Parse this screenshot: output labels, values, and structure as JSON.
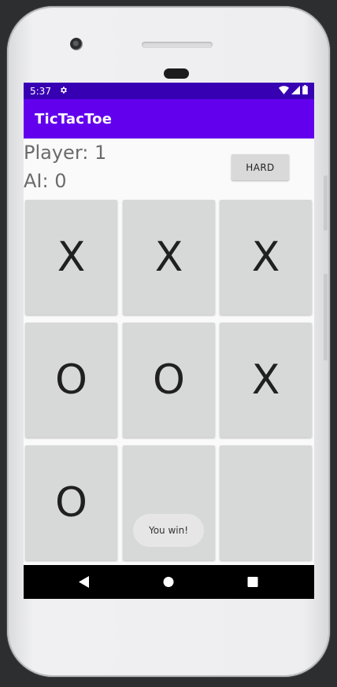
{
  "status_bar": {
    "time": "5:37",
    "icons": [
      "gear-icon",
      "wifi-icon",
      "signal-icon",
      "battery-icon"
    ]
  },
  "app_bar": {
    "title": "TicTacToe"
  },
  "scores": {
    "player": "Player: 1",
    "ai": "AI: 0"
  },
  "difficulty_button": {
    "label": "HARD"
  },
  "board": {
    "cells": [
      "X",
      "X",
      "X",
      "O",
      "O",
      "X",
      "O",
      "",
      ""
    ]
  },
  "toast": {
    "message": "You win!"
  },
  "navigation": {
    "icons": [
      "back-icon",
      "home-icon",
      "recents-icon"
    ]
  },
  "colors": {
    "status_bar": "#3700b3",
    "app_bar": "#6200ee",
    "cell": "#d7d8d8"
  }
}
